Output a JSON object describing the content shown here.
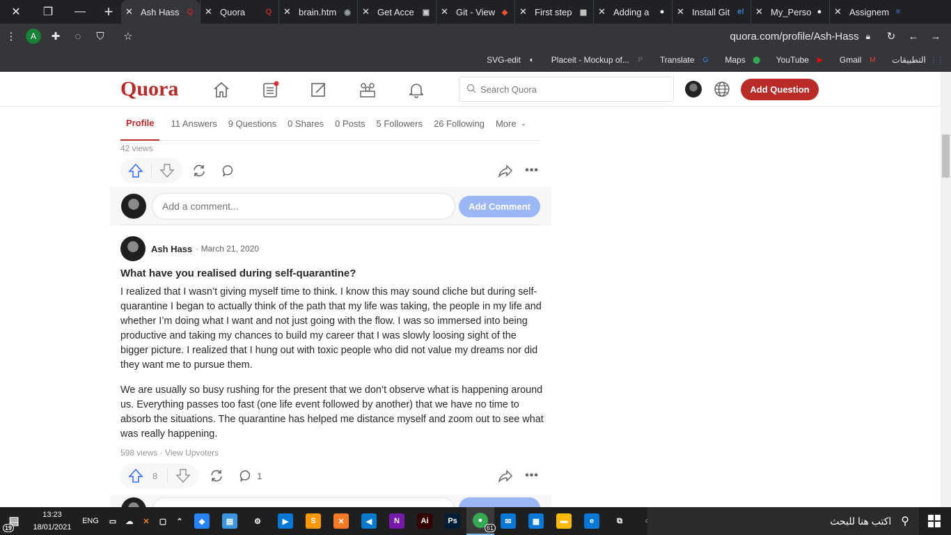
{
  "browser": {
    "tabs": [
      {
        "title": "Ash Hass",
        "fav": "Q",
        "fav_color": "#b92b27",
        "active": true
      },
      {
        "title": "Quora",
        "fav": "Q",
        "fav_color": "#b92b27"
      },
      {
        "title": "brain.htm",
        "fav": "◉",
        "fav_color": "#9aa0a6"
      },
      {
        "title": "Get Acce",
        "fav": "▣",
        "fav_color": "#cfcfcf"
      },
      {
        "title": "Git - View",
        "fav": "◆",
        "fav_color": "#f05133"
      },
      {
        "title": "First step",
        "fav": "▦",
        "fav_color": "#cfcfcf"
      },
      {
        "title": "Adding a",
        "fav": "●",
        "fav_color": "#ffffff"
      },
      {
        "title": "Install Git",
        "fav": "e!",
        "fav_color": "#3a8ee6"
      },
      {
        "title": "My_Perso",
        "fav": "●",
        "fav_color": "#ffffff"
      },
      {
        "title": "Assignem",
        "fav": "≡",
        "fav_color": "#4285f4"
      }
    ],
    "profile_initial": "A",
    "url": "quora.com/profile/Ash-Hass",
    "bookmarks": [
      {
        "label": "SVG-edit",
        "ic": "◐",
        "color": "#ffffff"
      },
      {
        "label": "Placeit - Mockup of...",
        "ic": "P",
        "color": "#777777"
      },
      {
        "label": "Translate",
        "ic": "G",
        "color": "#4285f4"
      },
      {
        "label": "Maps",
        "ic": "⬤",
        "color": "#34a853"
      },
      {
        "label": "YouTube",
        "ic": "▶",
        "color": "#ff0000"
      },
      {
        "label": "Gmail",
        "ic": "M",
        "color": "#ea4335"
      },
      {
        "label": "التطبيقات",
        "ic": "⋮⋮",
        "color": "#4285f4"
      }
    ]
  },
  "quora": {
    "logo": "Quora",
    "search_placeholder": "Search Quora",
    "add_question": "Add Question",
    "accent": "#b92b27"
  },
  "profile_tabs": [
    "Profile",
    "11 Answers",
    "9 Questions",
    "0 Shares",
    "0 Posts",
    "5 Followers",
    "26 Following",
    "More"
  ],
  "first_post": {
    "views": "42 views",
    "comment_placeholder": "Add a comment...",
    "add_comment": "Add Comment"
  },
  "second_post": {
    "author": "Ash Hass",
    "date": "· March 21, 2020",
    "title": "What have you realised during self-quarantine?",
    "paragraphs": [
      "I realized that I wasn’t giving myself time to think. I know this may sound cliche but during self-quarantine I began to actually think of the path that my life was taking, the people in my life and whether I’m doing what I want and not just going with the flow. I was so immersed into being productive and taking my chances to build my career that I was slowly loosing sight of the bigger picture. I realized that I hung out with toxic people who did not value my dreams nor did they want me to pursue them.",
      "We are usually so busy rushing for the present that we don’t observe what is happening around us. Everything passes too fast (one life event followed by another) that we have no time to absorb the situations. The quarantine has helped me distance myself and zoom out to see what was really happening."
    ],
    "stats": "598 views · View Upvoters",
    "upvotes": "8",
    "comments": "1"
  },
  "taskbar": {
    "time": "13:23",
    "date": "18/01/2021",
    "lang": "ENG",
    "notif_count": "19",
    "chrome_badge": "61",
    "search_text": "اكتب هنا للبحث",
    "apps": [
      {
        "name": "sourcetree",
        "label": "◆",
        "color": "#2684ff"
      },
      {
        "name": "contacts",
        "label": "▤",
        "color": "#3a96dd"
      },
      {
        "name": "settings",
        "label": "⚙",
        "color": "#1f1f1f"
      },
      {
        "name": "video",
        "label": "▶",
        "color": "#0078d7"
      },
      {
        "name": "sublime",
        "label": "S",
        "color": "#ff9800"
      },
      {
        "name": "xampp",
        "label": "✕",
        "color": "#fb7a24"
      },
      {
        "name": "vscode",
        "label": "◀",
        "color": "#007acc"
      },
      {
        "name": "onenote",
        "label": "N",
        "color": "#7719aa"
      },
      {
        "name": "illustrator",
        "label": "Ai",
        "color": "#330000"
      },
      {
        "name": "photoshop",
        "label": "Ps",
        "color": "#001e36"
      },
      {
        "name": "chrome",
        "label": "●",
        "color": "#34a853"
      },
      {
        "name": "mail",
        "label": "✉",
        "color": "#0078d7"
      },
      {
        "name": "store",
        "label": "▦",
        "color": "#0078d7"
      },
      {
        "name": "explorer",
        "label": "▬",
        "color": "#ffb900"
      },
      {
        "name": "edge",
        "label": "e",
        "color": "#0078d7"
      },
      {
        "name": "taskview",
        "label": "⧉",
        "color": "#1f1f1f"
      },
      {
        "name": "cortana",
        "label": "○",
        "color": "#1f1f1f"
      }
    ]
  }
}
